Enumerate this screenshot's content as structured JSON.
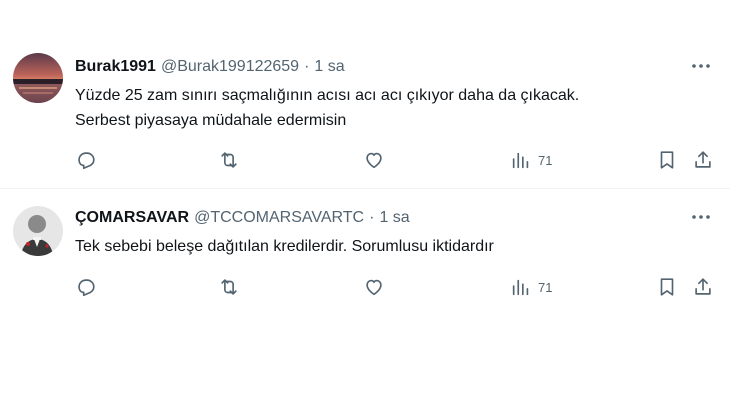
{
  "tweets": [
    {
      "display_name": "Burak1991",
      "handle": "@Burak199122659",
      "separator": "·",
      "time": "1 sa",
      "text_lines": [
        "Yüzde 25 zam sınırı saçmalığının acısı acı acı çıkıyor daha da çıkacak.",
        "Serbest piyasaya müdahale edermisin"
      ],
      "views": "71",
      "avatar_icon": "sunset-landscape-avatar"
    },
    {
      "display_name": "ÇOMARSAVAR",
      "handle": "@TCCOMARSAVARTC",
      "separator": "·",
      "time": "1 sa",
      "text_lines": [
        "Tek sebebi beleşe dağıtılan kredilerdir. Sorumlusu iktidardır"
      ],
      "views": "71",
      "avatar_icon": "portrait-avatar"
    }
  ],
  "icons": [
    "reply-icon",
    "retweet-icon",
    "like-icon",
    "views-icon",
    "bookmark-icon",
    "share-icon",
    "more-icon"
  ],
  "colors": {
    "text_primary": "#0f1419",
    "text_secondary": "#536471",
    "divider": "#eff3f4"
  }
}
